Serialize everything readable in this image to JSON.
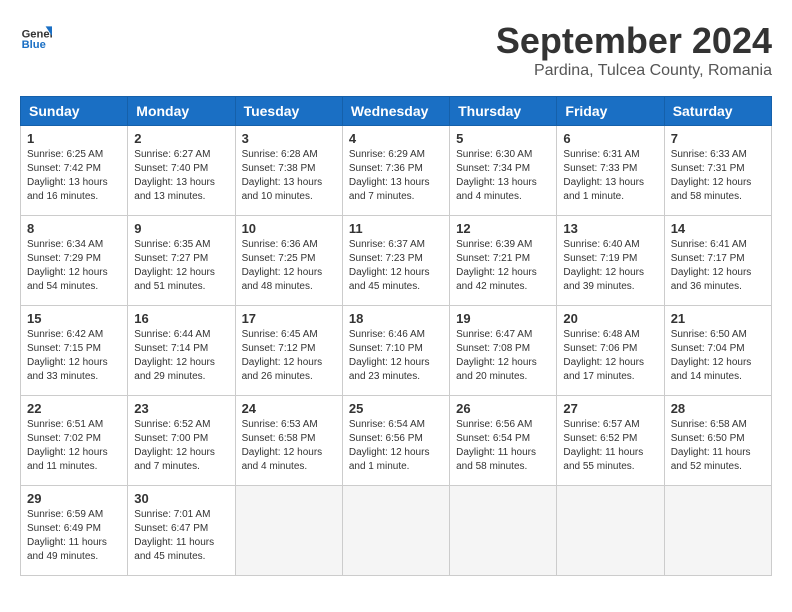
{
  "header": {
    "logo": {
      "general": "General",
      "blue": "Blue"
    },
    "title": "September 2024",
    "location": "Pardina, Tulcea County, Romania"
  },
  "calendar": {
    "days_of_week": [
      "Sunday",
      "Monday",
      "Tuesday",
      "Wednesday",
      "Thursday",
      "Friday",
      "Saturday"
    ],
    "weeks": [
      [
        null,
        {
          "day": "2",
          "info": "Sunrise: 6:27 AM\nSunset: 7:40 PM\nDaylight: 13 hours\nand 13 minutes."
        },
        {
          "day": "3",
          "info": "Sunrise: 6:28 AM\nSunset: 7:38 PM\nDaylight: 13 hours\nand 10 minutes."
        },
        {
          "day": "4",
          "info": "Sunrise: 6:29 AM\nSunset: 7:36 PM\nDaylight: 13 hours\nand 7 minutes."
        },
        {
          "day": "5",
          "info": "Sunrise: 6:30 AM\nSunset: 7:34 PM\nDaylight: 13 hours\nand 4 minutes."
        },
        {
          "day": "6",
          "info": "Sunrise: 6:31 AM\nSunset: 7:33 PM\nDaylight: 13 hours\nand 1 minute."
        },
        {
          "day": "7",
          "info": "Sunrise: 6:33 AM\nSunset: 7:31 PM\nDaylight: 12 hours\nand 58 minutes."
        }
      ],
      [
        {
          "day": "1",
          "info": "Sunrise: 6:25 AM\nSunset: 7:42 PM\nDaylight: 13 hours\nand 16 minutes."
        },
        null,
        null,
        null,
        null,
        null,
        null
      ],
      [
        {
          "day": "8",
          "info": "Sunrise: 6:34 AM\nSunset: 7:29 PM\nDaylight: 12 hours\nand 54 minutes."
        },
        {
          "day": "9",
          "info": "Sunrise: 6:35 AM\nSunset: 7:27 PM\nDaylight: 12 hours\nand 51 minutes."
        },
        {
          "day": "10",
          "info": "Sunrise: 6:36 AM\nSunset: 7:25 PM\nDaylight: 12 hours\nand 48 minutes."
        },
        {
          "day": "11",
          "info": "Sunrise: 6:37 AM\nSunset: 7:23 PM\nDaylight: 12 hours\nand 45 minutes."
        },
        {
          "day": "12",
          "info": "Sunrise: 6:39 AM\nSunset: 7:21 PM\nDaylight: 12 hours\nand 42 minutes."
        },
        {
          "day": "13",
          "info": "Sunrise: 6:40 AM\nSunset: 7:19 PM\nDaylight: 12 hours\nand 39 minutes."
        },
        {
          "day": "14",
          "info": "Sunrise: 6:41 AM\nSunset: 7:17 PM\nDaylight: 12 hours\nand 36 minutes."
        }
      ],
      [
        {
          "day": "15",
          "info": "Sunrise: 6:42 AM\nSunset: 7:15 PM\nDaylight: 12 hours\nand 33 minutes."
        },
        {
          "day": "16",
          "info": "Sunrise: 6:44 AM\nSunset: 7:14 PM\nDaylight: 12 hours\nand 29 minutes."
        },
        {
          "day": "17",
          "info": "Sunrise: 6:45 AM\nSunset: 7:12 PM\nDaylight: 12 hours\nand 26 minutes."
        },
        {
          "day": "18",
          "info": "Sunrise: 6:46 AM\nSunset: 7:10 PM\nDaylight: 12 hours\nand 23 minutes."
        },
        {
          "day": "19",
          "info": "Sunrise: 6:47 AM\nSunset: 7:08 PM\nDaylight: 12 hours\nand 20 minutes."
        },
        {
          "day": "20",
          "info": "Sunrise: 6:48 AM\nSunset: 7:06 PM\nDaylight: 12 hours\nand 17 minutes."
        },
        {
          "day": "21",
          "info": "Sunrise: 6:50 AM\nSunset: 7:04 PM\nDaylight: 12 hours\nand 14 minutes."
        }
      ],
      [
        {
          "day": "22",
          "info": "Sunrise: 6:51 AM\nSunset: 7:02 PM\nDaylight: 12 hours\nand 11 minutes."
        },
        {
          "day": "23",
          "info": "Sunrise: 6:52 AM\nSunset: 7:00 PM\nDaylight: 12 hours\nand 7 minutes."
        },
        {
          "day": "24",
          "info": "Sunrise: 6:53 AM\nSunset: 6:58 PM\nDaylight: 12 hours\nand 4 minutes."
        },
        {
          "day": "25",
          "info": "Sunrise: 6:54 AM\nSunset: 6:56 PM\nDaylight: 12 hours\nand 1 minute."
        },
        {
          "day": "26",
          "info": "Sunrise: 6:56 AM\nSunset: 6:54 PM\nDaylight: 11 hours\nand 58 minutes."
        },
        {
          "day": "27",
          "info": "Sunrise: 6:57 AM\nSunset: 6:52 PM\nDaylight: 11 hours\nand 55 minutes."
        },
        {
          "day": "28",
          "info": "Sunrise: 6:58 AM\nSunset: 6:50 PM\nDaylight: 11 hours\nand 52 minutes."
        }
      ],
      [
        {
          "day": "29",
          "info": "Sunrise: 6:59 AM\nSunset: 6:49 PM\nDaylight: 11 hours\nand 49 minutes."
        },
        {
          "day": "30",
          "info": "Sunrise: 7:01 AM\nSunset: 6:47 PM\nDaylight: 11 hours\nand 45 minutes."
        },
        null,
        null,
        null,
        null,
        null
      ]
    ]
  }
}
